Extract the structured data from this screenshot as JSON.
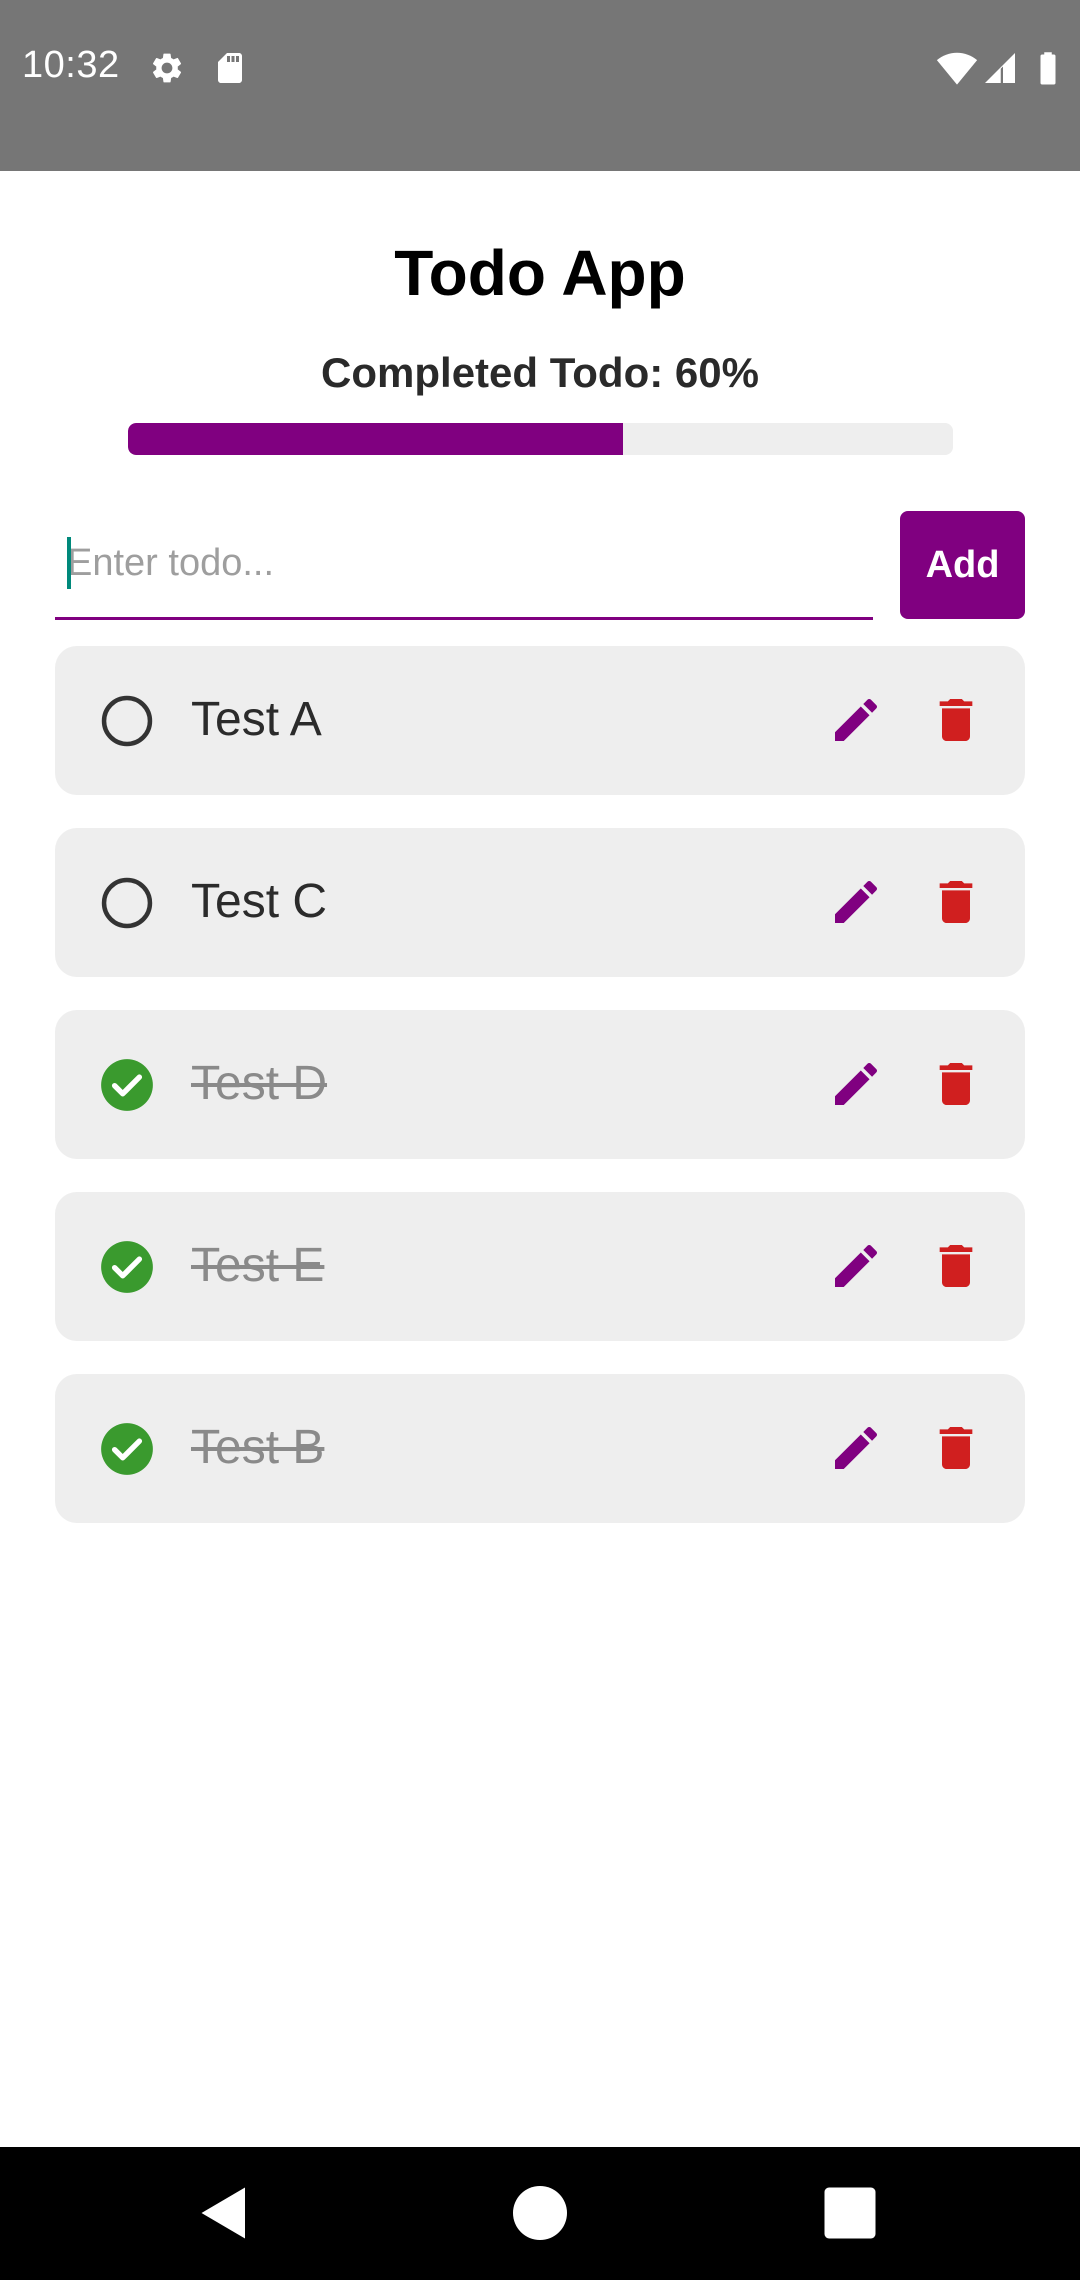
{
  "status_bar": {
    "time": "10:32",
    "icons": [
      "gear-icon",
      "sd-card-icon",
      "wifi-icon",
      "cell-signal-icon",
      "battery-icon"
    ]
  },
  "app": {
    "title": "Todo App",
    "progress_label": "Completed Todo: 60%",
    "progress_fraction": 0.6
  },
  "input": {
    "placeholder": "Enter todo...",
    "value": "",
    "add_label": "Add"
  },
  "todos": [
    {
      "text": "Test A",
      "done": false
    },
    {
      "text": "Test C",
      "done": false
    },
    {
      "text": "Test D",
      "done": true
    },
    {
      "text": "Test E",
      "done": true
    },
    {
      "text": "Test B",
      "done": true
    }
  ],
  "colors": {
    "accent": "#800080",
    "done_check": "#3a9a2e",
    "delete": "#d01f1f",
    "status_bar": "#767676",
    "card": "#eeeeee"
  },
  "nav_bar": {
    "buttons": [
      "back-icon",
      "home-icon",
      "recents-icon"
    ]
  }
}
